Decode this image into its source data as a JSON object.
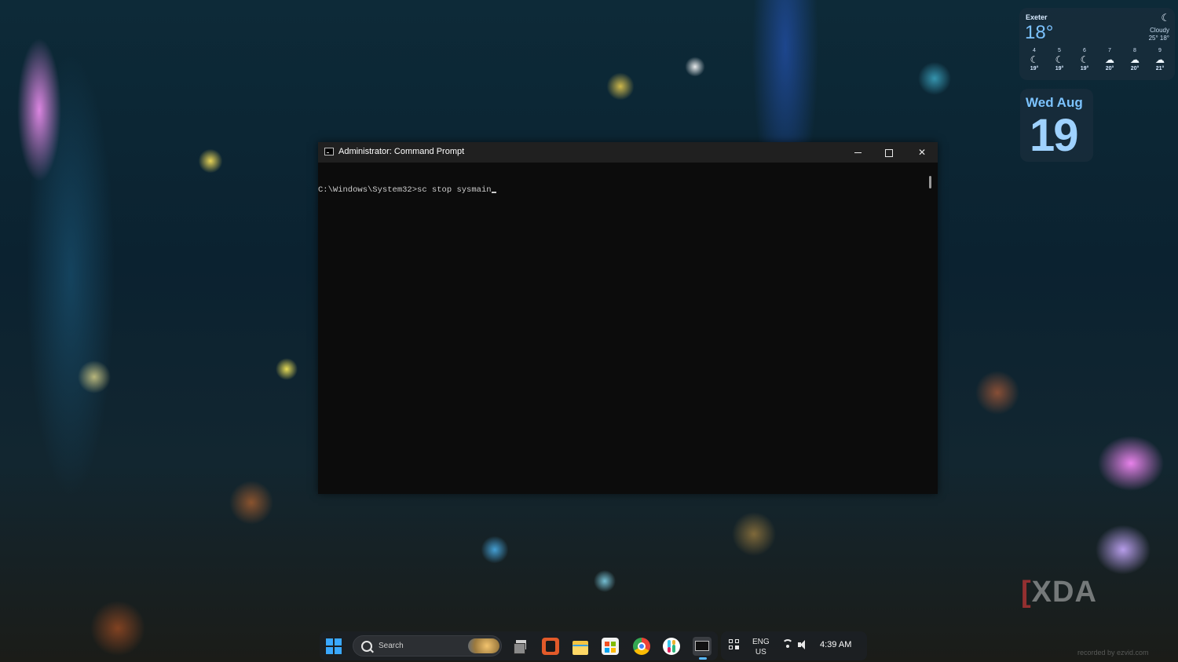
{
  "weather": {
    "city": "Exeter",
    "temp": "18°",
    "condition": "Cloudy",
    "hilo": "25° 18°",
    "icon": "moon-icon",
    "forecast": [
      {
        "hour": "4",
        "icon": "moon-icon",
        "temp": "19°"
      },
      {
        "hour": "5",
        "icon": "moon-icon",
        "temp": "19°"
      },
      {
        "hour": "6",
        "icon": "moon-icon",
        "temp": "19°"
      },
      {
        "hour": "7",
        "icon": "cloud-rain-icon",
        "temp": "20°"
      },
      {
        "hour": "8",
        "icon": "cloud-rain-icon",
        "temp": "20°"
      },
      {
        "hour": "9",
        "icon": "cloud-icon",
        "temp": "21°"
      }
    ]
  },
  "date_widget": {
    "weekday_month": "Wed Aug",
    "day": "19"
  },
  "cmd": {
    "title": "Administrator: Command Prompt",
    "prompt": "C:\\Windows\\System32>",
    "command": "sc stop sysmain"
  },
  "watermark": {
    "brand": "XDA",
    "recorded": "recorded by ezvid.com"
  },
  "taskbar": {
    "search_label": "Search",
    "lang_top": "ENG",
    "lang_bottom": "US",
    "time": "4:39 AM"
  },
  "colors": {
    "start_blue": "#3aa8ff",
    "console_bg": "#0c0c0c",
    "widget_accent": "#7cc3ff"
  }
}
